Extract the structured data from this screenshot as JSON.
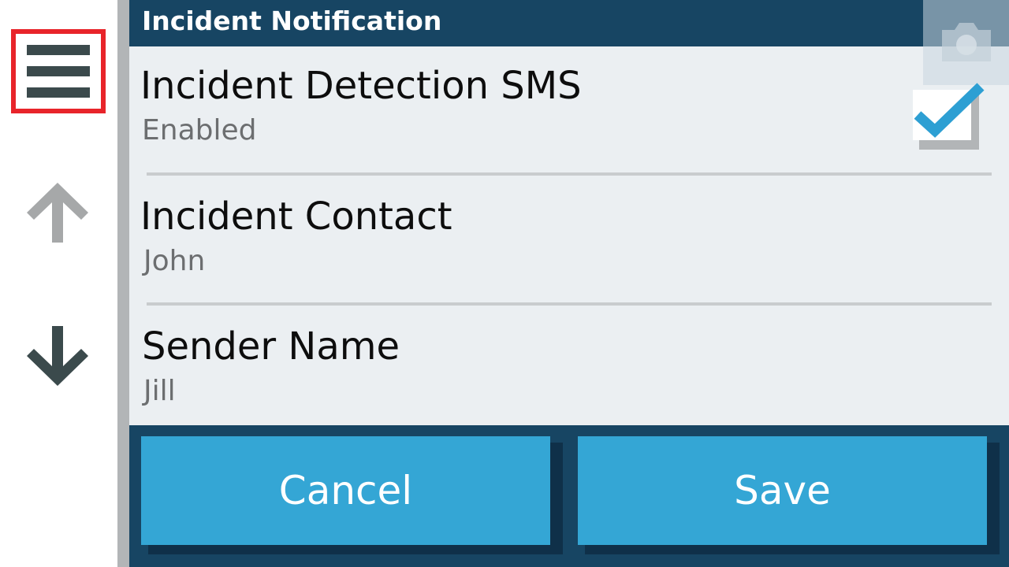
{
  "header": {
    "title": "Incident Notification"
  },
  "nav": {
    "menu_icon": "hamburger-menu-icon",
    "up_icon": "arrow-up-icon",
    "down_icon": "arrow-down-icon",
    "camera_icon": "camera-icon"
  },
  "settings": [
    {
      "label": "Incident Detection SMS",
      "value": "Enabled",
      "checked": true
    },
    {
      "label": "Incident Contact",
      "value": "John"
    },
    {
      "label": "Sender Name",
      "value": "Jill"
    }
  ],
  "footer": {
    "cancel_label": "Cancel",
    "save_label": "Save"
  },
  "colors": {
    "header_bg": "#174563",
    "content_bg": "#ebeff2",
    "button_bg": "#34a6d5",
    "highlight_border": "#e8242a",
    "icon_dark": "#3b4a4c",
    "icon_disabled": "#a6a8a9"
  }
}
